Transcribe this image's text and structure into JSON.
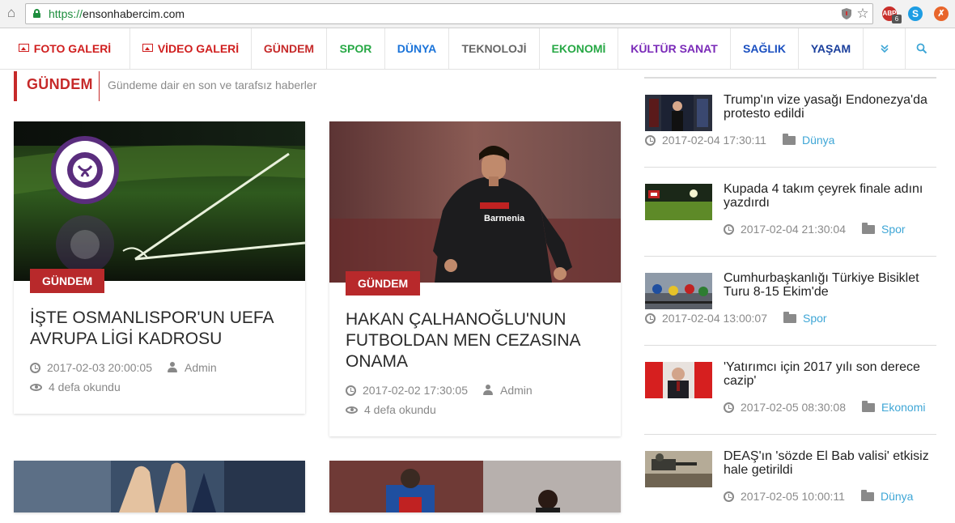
{
  "browser": {
    "url_scheme": "https://",
    "url_host": "ensonhabercim.com",
    "adblock_count": "6"
  },
  "nav": {
    "items": [
      {
        "label": "FOTO GALERİ",
        "color": "#d01f1f",
        "icon": "picture-icon"
      },
      {
        "label": "VİDEO GALERİ",
        "color": "#d01f1f",
        "icon": "picture-icon"
      },
      {
        "label": "GÜNDEM",
        "color": "#c62a2a"
      },
      {
        "label": "SPOR",
        "color": "#27a845"
      },
      {
        "label": "DÜNYA",
        "color": "#1a73d9"
      },
      {
        "label": "TEKNOLOJİ",
        "color": "#666666"
      },
      {
        "label": "EKONOMİ",
        "color": "#27a845"
      },
      {
        "label": "KÜLTÜR SANAT",
        "color": "#7a2ab8"
      },
      {
        "label": "SAĞLIK",
        "color": "#1a4fc0"
      },
      {
        "label": "YAŞAM",
        "color": "#1a3f9c"
      }
    ],
    "more_icon": "double-chevron-down-icon",
    "search_icon": "search-icon"
  },
  "section": {
    "title": "GÜNDEM",
    "subtitle": "Gündeme dair en son ve tarafsız haberler",
    "accent": "#c62a2a"
  },
  "articles": [
    {
      "category": "GÜNDEM",
      "title": "İŞTE OSMANLISPOR'UN UEFA AVRUPA LİGİ KADROSU",
      "date": "2017-02-03 20:00:05",
      "author": "Admin",
      "views": "4 defa okundu"
    },
    {
      "category": "GÜNDEM",
      "title": "HAKAN ÇALHANOĞLU'NUN FUTBOLDAN MEN CEZASINA ONAMA",
      "date": "2017-02-02 17:30:05",
      "author": "Admin",
      "views": "4 defa okundu"
    }
  ],
  "sidebar": {
    "items": [
      {
        "title": "Trump'ın vize yasağı Endonezya'da protesto edildi",
        "date": "2017-02-04 17:30:11",
        "category": "Dünya"
      },
      {
        "title": "Kupada 4 takım çeyrek finale adını yazdırdı",
        "date": "2017-02-04 21:30:04",
        "category": "Spor"
      },
      {
        "title": "Cumhurbaşkanlığı Türkiye Bisiklet Turu 8-15 Ekim'de",
        "date": "2017-02-04 13:00:07",
        "category": "Spor"
      },
      {
        "title": "'Yatırımcı için 2017 yılı son derece cazip'",
        "date": "2017-02-05 08:30:08",
        "category": "Ekonomi"
      },
      {
        "title": "DEAŞ'ın 'sözde El Bab valisi' etkisiz hale getirildi",
        "date": "2017-02-05 10:00:11",
        "category": "Dünya"
      }
    ]
  }
}
